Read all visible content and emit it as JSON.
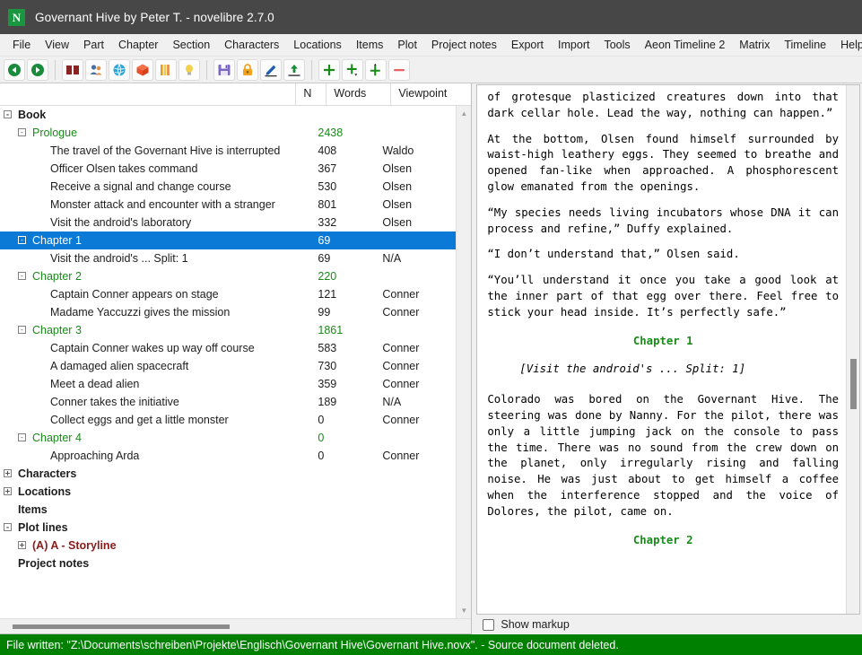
{
  "window": {
    "logo_letter": "N",
    "title": "Governant Hive by Peter T. - novelibre 2.7.0"
  },
  "menubar": {
    "items": [
      {
        "label": "File",
        "name": "menu-file"
      },
      {
        "label": "View",
        "name": "menu-view"
      },
      {
        "label": "Part",
        "name": "menu-part"
      },
      {
        "label": "Chapter",
        "name": "menu-chapter"
      },
      {
        "label": "Section",
        "name": "menu-section"
      },
      {
        "label": "Characters",
        "name": "menu-characters"
      },
      {
        "label": "Locations",
        "name": "menu-locations"
      },
      {
        "label": "Items",
        "name": "menu-items"
      },
      {
        "label": "Plot",
        "name": "menu-plot"
      },
      {
        "label": "Project notes",
        "name": "menu-project-notes"
      },
      {
        "label": "Export",
        "name": "menu-export"
      },
      {
        "label": "Import",
        "name": "menu-import"
      },
      {
        "label": "Tools",
        "name": "menu-tools"
      },
      {
        "label": "Aeon Timeline 2",
        "name": "menu-aeon-timeline-2"
      },
      {
        "label": "Matrix",
        "name": "menu-matrix"
      },
      {
        "label": "Timeline",
        "name": "menu-timeline"
      },
      {
        "label": "Help",
        "name": "menu-help"
      }
    ]
  },
  "toolbar": {
    "buttons": [
      {
        "icon": "back-arrow-icon",
        "color": "#1a8a3c"
      },
      {
        "icon": "forward-arrow-icon",
        "color": "#1a8a3c"
      },
      {
        "sep": true
      },
      {
        "icon": "book-icon",
        "color": "#8b2323"
      },
      {
        "icon": "characters-icon",
        "color": "#4a6fa5"
      },
      {
        "icon": "locations-globe-icon",
        "color": "#29a3d6"
      },
      {
        "icon": "items-box-icon",
        "color": "#e8502a"
      },
      {
        "icon": "plot-lines-icon",
        "color": "#e0a020"
      },
      {
        "icon": "project-notes-bulb-icon",
        "color": "#f2c94c"
      },
      {
        "sep": true
      },
      {
        "icon": "save-icon",
        "color": "#7b68c4"
      },
      {
        "icon": "lock-icon",
        "color": "#f2a31b"
      },
      {
        "icon": "edit-pencil-icon",
        "color": "#1e5fb4"
      },
      {
        "icon": "export-up-icon",
        "color": "#1a8a3c"
      },
      {
        "sep": true
      },
      {
        "icon": "add-child-icon",
        "color": "#1a8a1a"
      },
      {
        "icon": "add-sibling-icon",
        "color": "#1a8a1a"
      },
      {
        "icon": "add-parent-icon",
        "color": "#1a8a1a"
      },
      {
        "icon": "remove-icon",
        "color": "#e86060"
      }
    ]
  },
  "tree": {
    "columns": [
      {
        "label": "N",
        "name": "col-n"
      },
      {
        "label": "Words",
        "name": "col-words"
      },
      {
        "label": "Viewpoint",
        "name": "col-viewpoint"
      }
    ],
    "rows": [
      {
        "label": "Book",
        "level": 0,
        "toggle": "-",
        "words": "",
        "viewpoint": "",
        "style": "bold",
        "selected": false
      },
      {
        "label": "Prologue",
        "level": 1,
        "toggle": "-",
        "words": "2438",
        "viewpoint": "",
        "style": "green",
        "selected": false
      },
      {
        "label": "The travel of the Governant Hive is interrupted",
        "level": 2,
        "toggle": "",
        "words": "408",
        "viewpoint": "Waldo",
        "style": "",
        "selected": false
      },
      {
        "label": "Officer Olsen takes command",
        "level": 2,
        "toggle": "",
        "words": "367",
        "viewpoint": "Olsen",
        "style": "",
        "selected": false
      },
      {
        "label": "Receive a signal and change course",
        "level": 2,
        "toggle": "",
        "words": "530",
        "viewpoint": "Olsen",
        "style": "",
        "selected": false
      },
      {
        "label": "Monster attack and encounter with a stranger",
        "level": 2,
        "toggle": "",
        "words": "801",
        "viewpoint": "Olsen",
        "style": "",
        "selected": false
      },
      {
        "label": "Visit the android's laboratory",
        "level": 2,
        "toggle": "",
        "words": "332",
        "viewpoint": "Olsen",
        "style": "",
        "selected": false
      },
      {
        "label": "Chapter 1",
        "level": 1,
        "toggle": "-",
        "words": "69",
        "viewpoint": "",
        "style": "green",
        "selected": true
      },
      {
        "label": "Visit the android's ... Split: 1",
        "level": 2,
        "toggle": "",
        "words": "69",
        "viewpoint": "N/A",
        "style": "",
        "selected": false
      },
      {
        "label": "Chapter 2",
        "level": 1,
        "toggle": "-",
        "words": "220",
        "viewpoint": "",
        "style": "green",
        "selected": false
      },
      {
        "label": "Captain Conner appears on stage",
        "level": 2,
        "toggle": "",
        "words": "121",
        "viewpoint": "Conner",
        "style": "",
        "selected": false
      },
      {
        "label": "Madame Yaccuzzi gives the mission",
        "level": 2,
        "toggle": "",
        "words": "99",
        "viewpoint": "Conner",
        "style": "",
        "selected": false
      },
      {
        "label": "Chapter 3",
        "level": 1,
        "toggle": "-",
        "words": "1861",
        "viewpoint": "",
        "style": "green",
        "selected": false
      },
      {
        "label": "Captain Conner wakes up way off course",
        "level": 2,
        "toggle": "",
        "words": "583",
        "viewpoint": "Conner",
        "style": "",
        "selected": false
      },
      {
        "label": "A damaged alien spacecraft",
        "level": 2,
        "toggle": "",
        "words": "730",
        "viewpoint": "Conner",
        "style": "",
        "selected": false
      },
      {
        "label": "Meet a dead alien",
        "level": 2,
        "toggle": "",
        "words": "359",
        "viewpoint": "Conner",
        "style": "",
        "selected": false
      },
      {
        "label": "Conner takes the initiative",
        "level": 2,
        "toggle": "",
        "words": "189",
        "viewpoint": "N/A",
        "style": "",
        "selected": false
      },
      {
        "label": "Collect eggs and get a little monster",
        "level": 2,
        "toggle": "",
        "words": "0",
        "viewpoint": "Conner",
        "style": "",
        "selected": false
      },
      {
        "label": "Chapter 4",
        "level": 1,
        "toggle": "-",
        "words": "0",
        "viewpoint": "",
        "style": "green",
        "selected": false
      },
      {
        "label": "Approaching Arda",
        "level": 2,
        "toggle": "",
        "words": "0",
        "viewpoint": "Conner",
        "style": "",
        "selected": false
      },
      {
        "label": "Characters",
        "level": 0,
        "toggle": "+",
        "words": "",
        "viewpoint": "",
        "style": "bold",
        "selected": false
      },
      {
        "label": "Locations",
        "level": 0,
        "toggle": "+",
        "words": "",
        "viewpoint": "",
        "style": "bold",
        "selected": false
      },
      {
        "label": "Items",
        "level": 0,
        "toggle": "",
        "words": "",
        "viewpoint": "",
        "style": "bold",
        "selected": false
      },
      {
        "label": "Plot lines",
        "level": 0,
        "toggle": "-",
        "words": "",
        "viewpoint": "",
        "style": "bold",
        "selected": false
      },
      {
        "label": "(A) A - Storyline",
        "level": 1,
        "toggle": "+",
        "words": "",
        "viewpoint": "",
        "style": "maroon bold",
        "selected": false
      },
      {
        "label": "Project notes",
        "level": 0,
        "toggle": "",
        "words": "",
        "viewpoint": "",
        "style": "bold",
        "selected": false
      }
    ]
  },
  "editor": {
    "paragraphs": [
      {
        "kind": "body",
        "text": "of grotesque plasticized creatures down into that dark cellar hole. Lead the way, nothing can happen.”"
      },
      {
        "kind": "body",
        "text": "At the bottom, Olsen found himself surrounded by waist-high leathery eggs. They seemed to breathe and opened fan-like when approached. A phosphorescent glow emanated from the openings."
      },
      {
        "kind": "body",
        "text": "“My species needs living incubators whose DNA it can process and refine,” Duffy explained."
      },
      {
        "kind": "body",
        "text": "“I don’t understand that,” Olsen said."
      },
      {
        "kind": "body",
        "text": "“You’ll understand it once you take a good look at the inner part of that egg over there. Feel free to stick your head inside. It’s perfectly safe.”"
      },
      {
        "kind": "heading",
        "text": "Chapter 1"
      },
      {
        "kind": "split",
        "text": "[Visit the android's ... Split: 1]"
      },
      {
        "kind": "body",
        "text": "Colorado was bored on the Governant Hive. The steering was done by Nanny. For the pilot, there was only a little jumping jack on the console to pass the time. There was no sound from the crew down on the planet, only irregularly rising and falling noise. He was just about to get himself a coffee when the interference stopped and the voice of Dolores, the pilot, came on."
      },
      {
        "kind": "heading",
        "text": "Chapter 2"
      }
    ],
    "show_markup_label": "Show markup",
    "show_markup_checked": false
  },
  "statusbar": {
    "message": "File written: \"Z:\\Documents\\schreiben\\Projekte\\Englisch\\Governant Hive\\Governant Hive.novx\". - Source document deleted.",
    "background": "#008000"
  }
}
